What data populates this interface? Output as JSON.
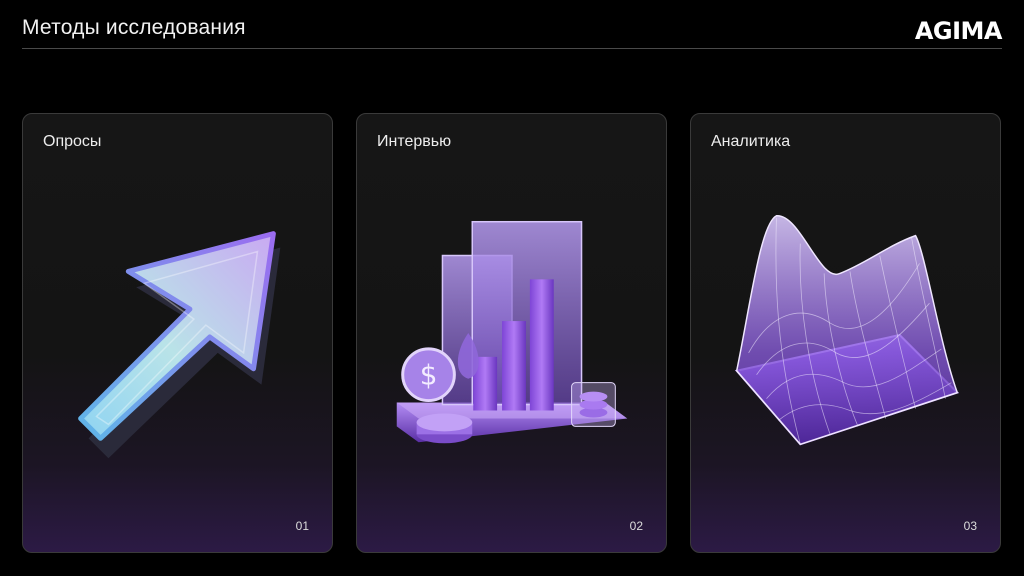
{
  "header": {
    "title": "Методы исследования",
    "logo": "AGIMA"
  },
  "cards": [
    {
      "title": "Опросы",
      "number": "01",
      "illustration": "arrow-icon"
    },
    {
      "title": "Интервью",
      "number": "02",
      "illustration": "bar-chart-icon"
    },
    {
      "title": "Аналитика",
      "number": "03",
      "illustration": "surface-graph-icon"
    }
  ],
  "colors": {
    "background": "#000000",
    "accent": "#9b6cf0",
    "card_border": "#3a3a3a"
  }
}
